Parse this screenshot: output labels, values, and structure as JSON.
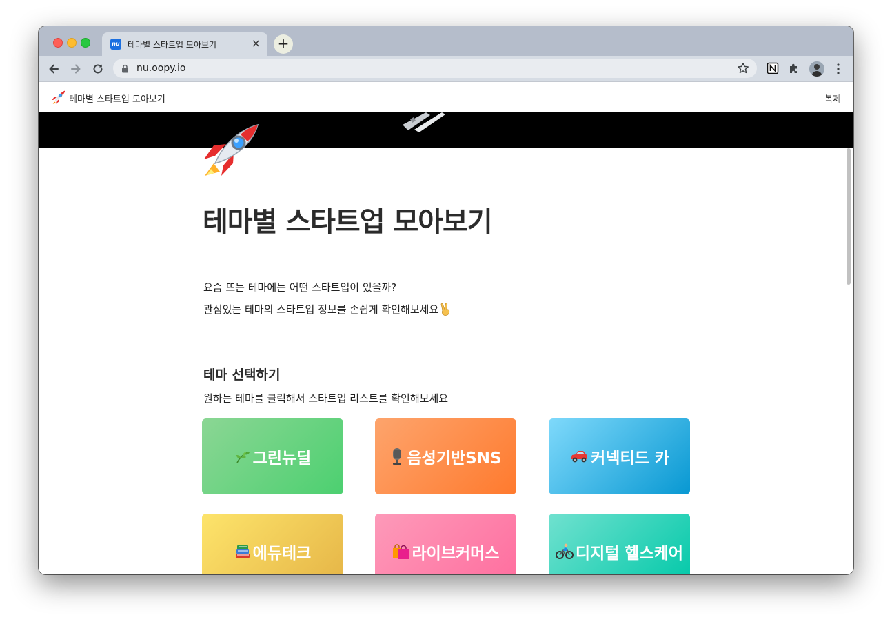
{
  "browser": {
    "tab_title": "테마별 스타트업 모아보기",
    "tab_favicon_text": "nu",
    "close_glyph": "×",
    "new_tab_glyph": "+",
    "url": "nu.oopy.io"
  },
  "page": {
    "topbar_title": "테마별 스타트업 모아보기",
    "duplicate_label": "복제",
    "title": "테마별 스타트업 모아보기",
    "intro_lines": [
      "요즘 뜨는 테마에는 어떤 스타트업이 있을까?",
      "관심있는 테마의 스타트업 정보를 손쉽게 확인해보세요"
    ],
    "section_title": "테마 선택하기",
    "section_desc": "원하는 테마를 클릭해서 스타트업 리스트를 확인해보세요",
    "themes": [
      {
        "label": "그린뉴딜",
        "icon": "herb-icon",
        "color_from": "#8bd694",
        "color_to": "#4cd070"
      },
      {
        "label": "음성기반SNS",
        "icon": "microphone-icon",
        "color_from": "#fda46c",
        "color_to": "#ff7a2e"
      },
      {
        "label": "커넥티드 카",
        "icon": "car-icon",
        "color_from": "#7fd9fb",
        "color_to": "#0898d2"
      },
      {
        "label": "에듀테크",
        "icon": "books-icon",
        "color_from": "#fde46b",
        "color_to": "#e5b446"
      },
      {
        "label": "라이브커머스",
        "icon": "shopping-bags-icon",
        "color_from": "#fd9ab9",
        "color_to": "#ff6d9e"
      },
      {
        "label": "디지털 헬스케어",
        "icon": "cyclist-icon",
        "color_from": "#70e1cf",
        "color_to": "#00c8a8"
      }
    ]
  },
  "colors": {
    "tabstrip": "#b5bdcb",
    "toolbar": "#d6dce4",
    "cover": "#000000"
  }
}
